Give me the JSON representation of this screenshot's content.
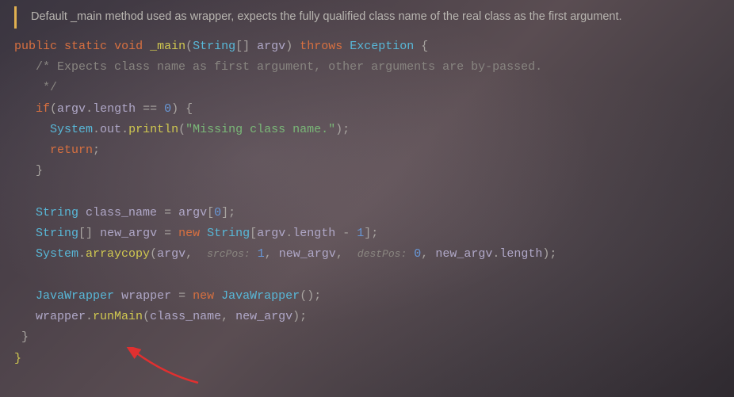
{
  "doc": "Default _main method used as wrapper, expects the fully qualified class name of the real class as the first argument.",
  "sig": {
    "public": "public",
    "static": "static",
    "void": "void",
    "name": "_main",
    "paramType": "String",
    "paramName": "argv",
    "throws": "throws",
    "exception": "Exception"
  },
  "comment": {
    "l1": "/* Expects class name as first argument, other arguments are by-passed.",
    "l2": " */"
  },
  "ifblock": {
    "if": "if",
    "argv": "argv",
    "length": "length",
    "eqeq": "==",
    "zero": "0",
    "system": "System",
    "out": "out",
    "println": "println",
    "msg": "\"Missing class name.\"",
    "return": "return"
  },
  "decl": {
    "String": "String",
    "class_name": "class_name",
    "argv": "argv",
    "zero": "0",
    "new_argv": "new_argv",
    "new": "new",
    "length": "length",
    "one": "1",
    "System": "System",
    "arraycopy": "arraycopy",
    "srcPos": "srcPos:",
    "srcPosVal": "1",
    "destPos": "destPos:",
    "destPosVal": "0"
  },
  "wrap": {
    "JavaWrapper": "JavaWrapper",
    "wrapper": "wrapper",
    "new": "new",
    "runMain": "runMain",
    "class_name": "class_name",
    "new_argv": "new_argv"
  }
}
